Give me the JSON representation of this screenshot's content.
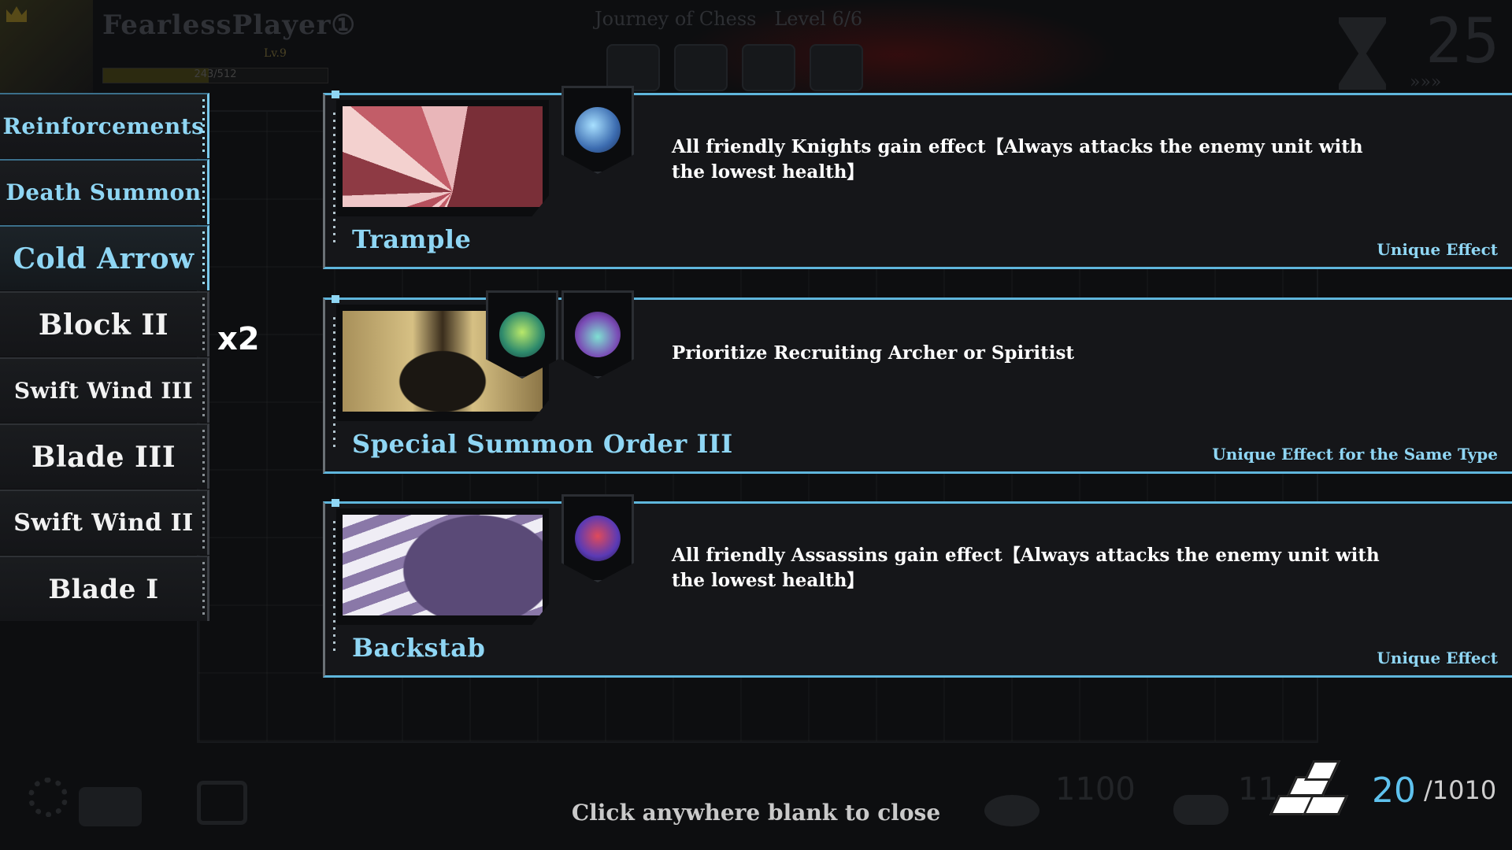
{
  "background": {
    "player_name": "FearlessPlayer①",
    "player_level": "Lv.9",
    "xp_text": "243/512",
    "xp_progress": 0.47,
    "stage_title": "Journey of Chess",
    "stage_level": "Level 6/6",
    "timer": "25",
    "speed": "»»»",
    "coins": "1100",
    "wood": "11"
  },
  "card_list": [
    {
      "label": "Reinforcements",
      "kind": "unique"
    },
    {
      "label": "Death Summon",
      "kind": "unique"
    },
    {
      "label": "Cold Arrow",
      "kind": "unique"
    },
    {
      "label": "Block II",
      "kind": "regular"
    },
    {
      "label": "Swift Wind III",
      "kind": "regular"
    },
    {
      "label": "Blade III",
      "kind": "regular"
    },
    {
      "label": "Swift Wind II",
      "kind": "regular"
    },
    {
      "label": "Blade I",
      "kind": "regular"
    }
  ],
  "multiplier": "x2",
  "panels": [
    {
      "title": "Trample",
      "description": "All friendly Knights gain effect【Always attacks the enemy unit with the lowest health】",
      "effect_type": "Unique Effect",
      "icons": [
        "knight-icon"
      ]
    },
    {
      "title": "Special Summon Order III",
      "description": "Prioritize Recruiting Archer or Spiritist",
      "effect_type": "Unique Effect for the Same Type",
      "icons": [
        "archer-icon",
        "spiritist-icon"
      ]
    },
    {
      "title": "Backstab",
      "description": "All friendly Assassins gain effect【Always attacks the enemy unit with the lowest health】",
      "effect_type": "Unique Effect",
      "icons": [
        "assassin-icon"
      ]
    }
  ],
  "close_hint": "Click anywhere blank to close",
  "currency": {
    "icon": "silver-ingot-icon",
    "value": "20",
    "max": "/1010"
  },
  "colors": {
    "accent": "#8fd6f4",
    "panel_border": "#5fb6dc",
    "background": "#0d0e10"
  }
}
